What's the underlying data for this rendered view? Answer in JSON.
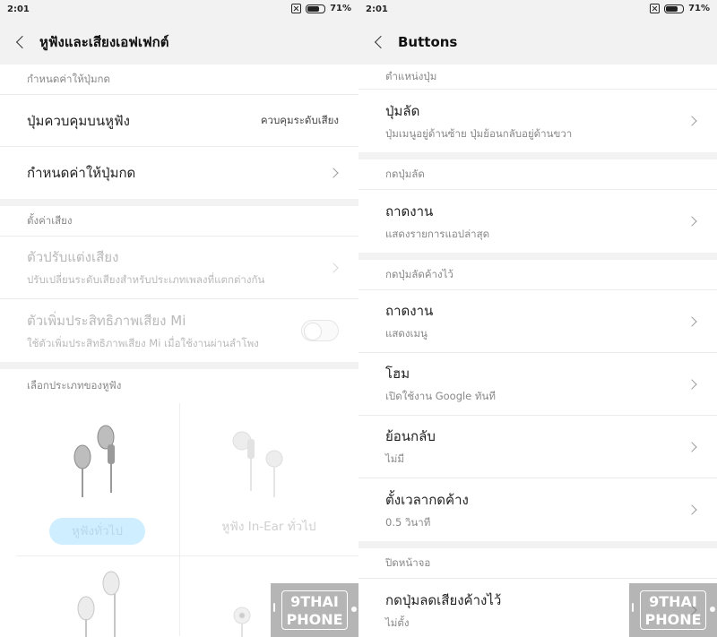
{
  "left": {
    "status": {
      "time": "2:01",
      "battery": "71%",
      "battery_level": 0.71
    },
    "title": "หูฟังและเสียงเอฟเฟกต์",
    "sections": {
      "buttons_header": "กำหนดค่าให้ปุ่มกด",
      "remote_control": {
        "label": "ปุ่มควบคุมบนหูฟัง",
        "value": "ควบคุมระดับเสียง"
      },
      "assign_buttons": {
        "label": "กำหนดค่าให้ปุ่มกด"
      },
      "sound_header": "ตั้งค่าเสียง",
      "equalizer": {
        "label": "ตัวปรับแต่งเสียง",
        "desc": "ปรับเปลี่ยนระดับเสียงสำหรับประเภทเพลงที่แตกต่างกัน"
      },
      "mi_enhancer": {
        "label": "ตัวเพิ่มประสิทธิภาพเสียง Mi",
        "desc": "ใช้ตัวเพิ่มประสิทธิภาพเสียง Mi เมื่อใช้งานผ่านลำโพง",
        "enabled": false
      },
      "earphone_header": "เลือกประเภทของหูฟัง",
      "earphones": [
        {
          "label": "หูฟังทั่วไป",
          "selected": true
        },
        {
          "label": "หูฟัง In-Ear ทั่วไป",
          "selected": false
        }
      ]
    },
    "watermark": {
      "line1": "9THAI",
      "line2": "PHONE"
    }
  },
  "right": {
    "status": {
      "time": "2:01",
      "battery": "71%",
      "battery_level": 0.71
    },
    "title": "Buttons",
    "groups": [
      {
        "header": "ตำแหน่งปุ่ม",
        "items": [
          {
            "label": "ปุ่มลัด",
            "desc": "ปุ่มเมนูอยู่ด้านซ้าย ปุ่มย้อนกลับอยู่ด้านขวา"
          }
        ]
      },
      {
        "header": "กดปุ่มลัด",
        "items": [
          {
            "label": "ถาดงาน",
            "desc": "แสดงรายการแอปล่าสุด"
          }
        ]
      },
      {
        "header": "กดปุ่มลัดค้างไว้",
        "items": [
          {
            "label": "ถาดงาน",
            "desc": "แสดงเมนู"
          },
          {
            "label": "โฮม",
            "desc": "เปิดใช้งาน Google ทันที"
          },
          {
            "label": "ย้อนกลับ",
            "desc": "ไม่มี"
          },
          {
            "label": "ตั้งเวลากดค้าง",
            "desc": "0.5 วินาที"
          }
        ]
      },
      {
        "header": "ปิดหน้าจอ",
        "items": [
          {
            "label": "กดปุ่มลดเสียงค้างไว้",
            "desc": "ไม่ตั้ง"
          }
        ]
      }
    ],
    "watermark": {
      "line1": "9THAI",
      "line2": "PHONE"
    }
  }
}
